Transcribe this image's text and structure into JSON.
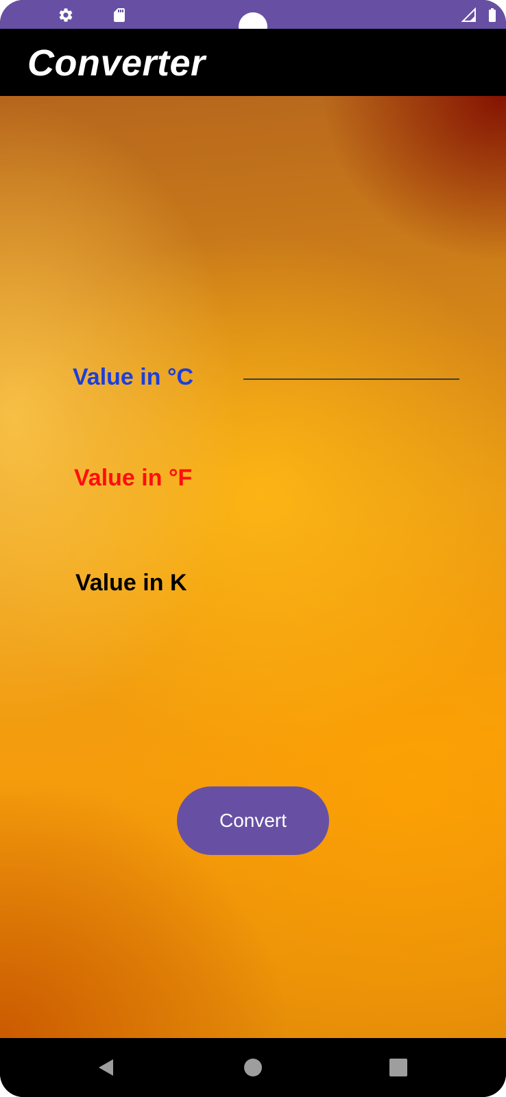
{
  "status_bar": {
    "icons": [
      "settings-icon",
      "sd-card-icon",
      "signal-icon",
      "battery-icon"
    ],
    "background": "#6750a4"
  },
  "app_bar": {
    "title": "Converter"
  },
  "form": {
    "celsius_label": "Value in °C",
    "fahrenheit_label": "Value in °F",
    "kelvin_label": "Value in K",
    "celsius_input_value": "",
    "celsius_label_color": "#1a3fdc",
    "fahrenheit_label_color": "#ff0d0d",
    "kelvin_label_color": "#000000"
  },
  "actions": {
    "convert_label": "Convert",
    "accent": "#6750a4"
  },
  "nav_bar": {
    "buttons": [
      "back-icon",
      "home-icon",
      "recents-icon"
    ]
  }
}
